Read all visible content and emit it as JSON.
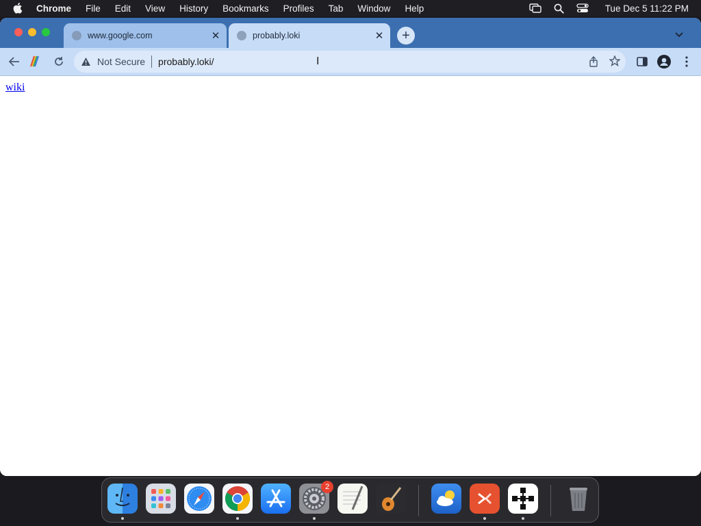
{
  "menubar": {
    "app_name": "Chrome",
    "items": [
      "File",
      "Edit",
      "View",
      "History",
      "Bookmarks",
      "Profiles",
      "Tab",
      "Window",
      "Help"
    ],
    "clock": "Tue Dec 5  11:22 PM"
  },
  "tabs": [
    {
      "title": "www.google.com",
      "active": false
    },
    {
      "title": "probably.loki",
      "active": true
    }
  ],
  "omnibox": {
    "security_label": "Not Secure",
    "url": "probably.loki/"
  },
  "page": {
    "link_text": "wiki"
  },
  "dock": {
    "apps": [
      {
        "name": "finder-icon",
        "running": true
      },
      {
        "name": "launchpad-icon",
        "running": false
      },
      {
        "name": "safari-icon",
        "running": false
      },
      {
        "name": "chrome-icon",
        "running": true
      },
      {
        "name": "app-store-icon",
        "running": false
      },
      {
        "name": "system-settings-icon",
        "running": true,
        "badge": "2"
      },
      {
        "name": "textedit-icon",
        "running": false
      },
      {
        "name": "garageband-icon",
        "running": false
      },
      {
        "name": "weather-icon",
        "running": false
      },
      {
        "name": "remote-desktop-icon",
        "running": true
      },
      {
        "name": "network-app-icon",
        "running": true
      },
      {
        "name": "trash-icon",
        "running": false
      }
    ]
  },
  "colors": {
    "tabstrip": "#3c6fb0",
    "toolbar": "#c7dcf7",
    "link": "#0000ee"
  }
}
